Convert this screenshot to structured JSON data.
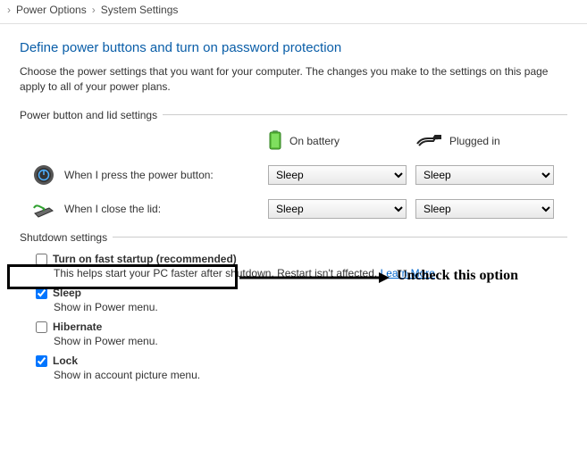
{
  "breadcrumb": {
    "a": "Power Options",
    "b": "System Settings"
  },
  "title": "Define power buttons and turn on password protection",
  "description": "Choose the power settings that you want for your computer. The changes you make to the settings on this page apply to all of your power plans.",
  "section_power": "Power button and lid settings",
  "cols": {
    "battery": "On battery",
    "plugged": "Plugged in"
  },
  "rows": {
    "power_btn": {
      "label": "When I press the power button:",
      "battery": "Sleep",
      "plugged": "Sleep"
    },
    "lid": {
      "label": "When I close the lid:",
      "battery": "Sleep",
      "plugged": "Sleep"
    }
  },
  "section_shutdown": "Shutdown settings",
  "shutdown": {
    "fast": {
      "label": "Turn on fast startup (recommended)",
      "sub": "This helps start your PC faster after shutdown. Restart isn't affected. ",
      "link": "Learn More"
    },
    "sleep": {
      "label": "Sleep",
      "sub": "Show in Power menu."
    },
    "hibernate": {
      "label": "Hibernate",
      "sub": "Show in Power menu."
    },
    "lock": {
      "label": "Lock",
      "sub": "Show in account picture menu."
    }
  },
  "annotation": "Uncheck this option"
}
